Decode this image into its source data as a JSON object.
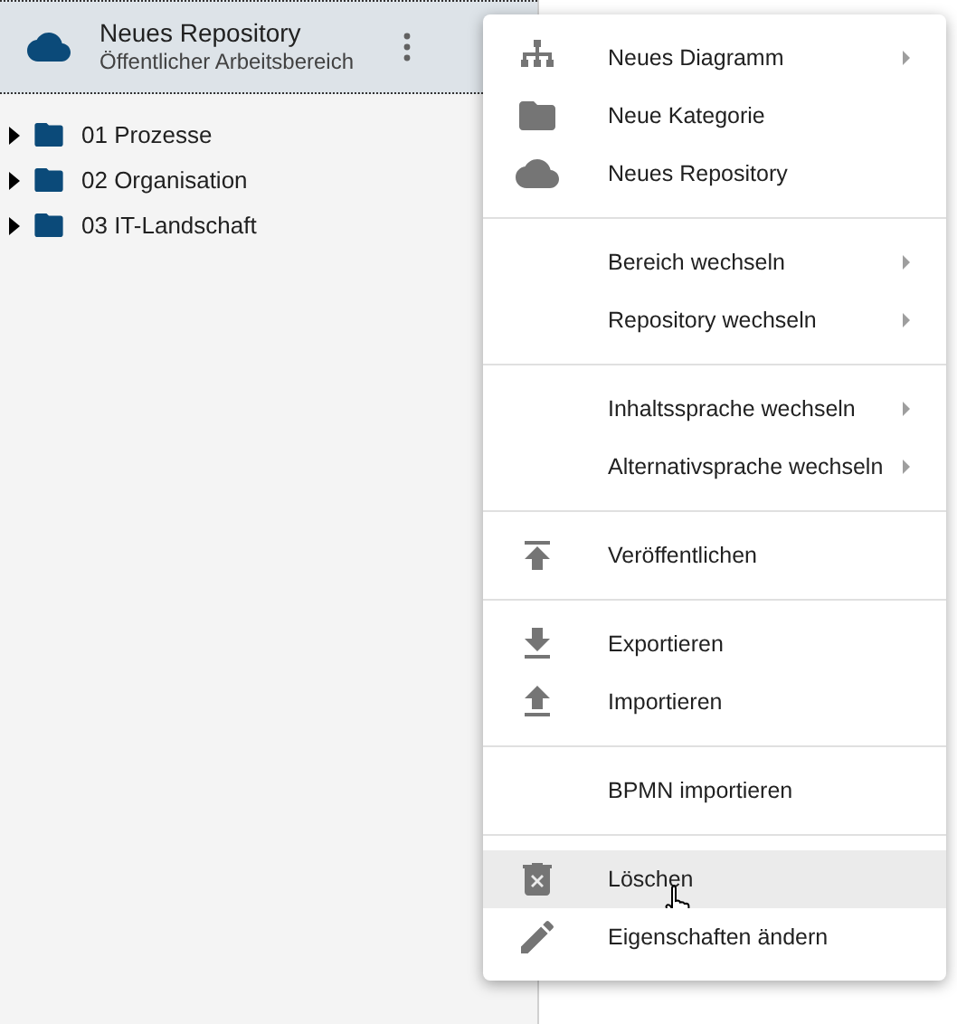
{
  "repository": {
    "title": "Neues Repository",
    "subtitle": "Öffentlicher Arbeitsbereich"
  },
  "tree": [
    {
      "label": "01 Prozesse",
      "expanded": false
    },
    {
      "label": "02 Organisation",
      "expanded": false
    },
    {
      "label": "03 IT-Landschaft",
      "expanded": false
    }
  ],
  "menu": {
    "sections": [
      {
        "items": [
          {
            "label": "Neues Diagramm",
            "kind": "sitemap",
            "submenu": true,
            "highlighted": false
          },
          {
            "label": "Neue Kategorie",
            "kind": "folder",
            "submenu": false,
            "highlighted": false
          },
          {
            "label": "Neues Repository",
            "kind": "cloud",
            "submenu": false,
            "highlighted": false
          }
        ]
      },
      {
        "items": [
          {
            "label": "Bereich wechseln",
            "kind": "plain",
            "submenu": true,
            "highlighted": false
          },
          {
            "label": "Repository wechseln",
            "kind": "plain",
            "submenu": true,
            "highlighted": false
          }
        ]
      },
      {
        "items": [
          {
            "label": "Inhaltssprache wechseln",
            "kind": "plain",
            "submenu": true,
            "highlighted": false
          },
          {
            "label": "Alternativsprache wechseln",
            "kind": "plain",
            "submenu": true,
            "highlighted": false
          }
        ]
      },
      {
        "items": [
          {
            "label": "Veröffentlichen",
            "kind": "publish",
            "submenu": false,
            "highlighted": false
          }
        ]
      },
      {
        "items": [
          {
            "label": "Exportieren",
            "kind": "download",
            "submenu": false,
            "highlighted": false
          },
          {
            "label": "Importieren",
            "kind": "upload",
            "submenu": false,
            "highlighted": false
          }
        ]
      },
      {
        "items": [
          {
            "label": "BPMN importieren",
            "kind": "plain",
            "submenu": false,
            "highlighted": false
          }
        ]
      },
      {
        "items": [
          {
            "label": "Löschen",
            "kind": "trash",
            "submenu": false,
            "highlighted": true
          },
          {
            "label": "Eigenschaften ändern",
            "kind": "pencil",
            "submenu": false,
            "highlighted": false
          }
        ]
      }
    ]
  }
}
